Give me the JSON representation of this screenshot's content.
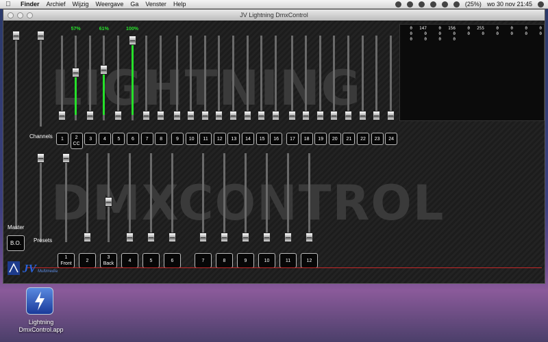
{
  "menubar": {
    "items": [
      "Finder",
      "Archief",
      "Wijzig",
      "Weergave",
      "Ga",
      "Venster",
      "Help"
    ],
    "battery": "(25%)",
    "clock": "wo 30 nov  21:45"
  },
  "window": {
    "title": "JV Lightning DmxControl"
  },
  "watermark": {
    "line1": "LIGHTNING",
    "line2": "DMXCONTROL"
  },
  "channels": {
    "label": "Channels",
    "buttons": [
      "1",
      "2",
      "3",
      "4",
      "5",
      "6",
      "7",
      "8",
      "9",
      "10",
      "11",
      "12",
      "13",
      "14",
      "15",
      "16",
      "17",
      "18",
      "19",
      "20",
      "21",
      "22",
      "23",
      "24"
    ],
    "sub": {
      "2": "CC"
    },
    "levels": [
      0,
      0.57,
      0,
      0.61,
      0,
      1.0,
      0,
      0,
      0,
      0,
      0,
      0,
      0,
      0,
      0,
      0,
      0,
      0,
      0,
      0,
      0,
      0,
      0,
      0
    ],
    "percent_labels": {
      "1": "57%",
      "3": "61%",
      "5": "100%"
    }
  },
  "presets": {
    "label": "Presets",
    "buttons": [
      "1",
      "2",
      "3",
      "4",
      "5",
      "6",
      "7",
      "8",
      "9",
      "10",
      "11",
      "12"
    ],
    "sub": {
      "0": "Front",
      "2": "Back"
    },
    "levels": [
      1.0,
      0,
      0.45,
      0,
      0,
      0,
      0,
      0,
      0,
      0,
      0,
      0
    ]
  },
  "master": {
    "label": "Master",
    "bo_label": "B.O.",
    "level": 1.0
  },
  "dmx_values": [
    [
      "0",
      "147",
      "0",
      "156",
      "0",
      "255",
      "0",
      "0",
      "0",
      "0"
    ],
    [
      "0",
      "0",
      "0",
      "0",
      "0",
      "0",
      "0",
      "0",
      "0",
      "0"
    ],
    [
      "0",
      "0",
      "0",
      "0"
    ]
  ],
  "logo": {
    "text": "JV",
    "subtext": "Multimedia"
  },
  "desktop": {
    "icon_label_1": "Lightning",
    "icon_label_2": "DmxControl.app"
  },
  "colors": {
    "accent_green": "#26e02a",
    "line_red": "#c62828"
  }
}
